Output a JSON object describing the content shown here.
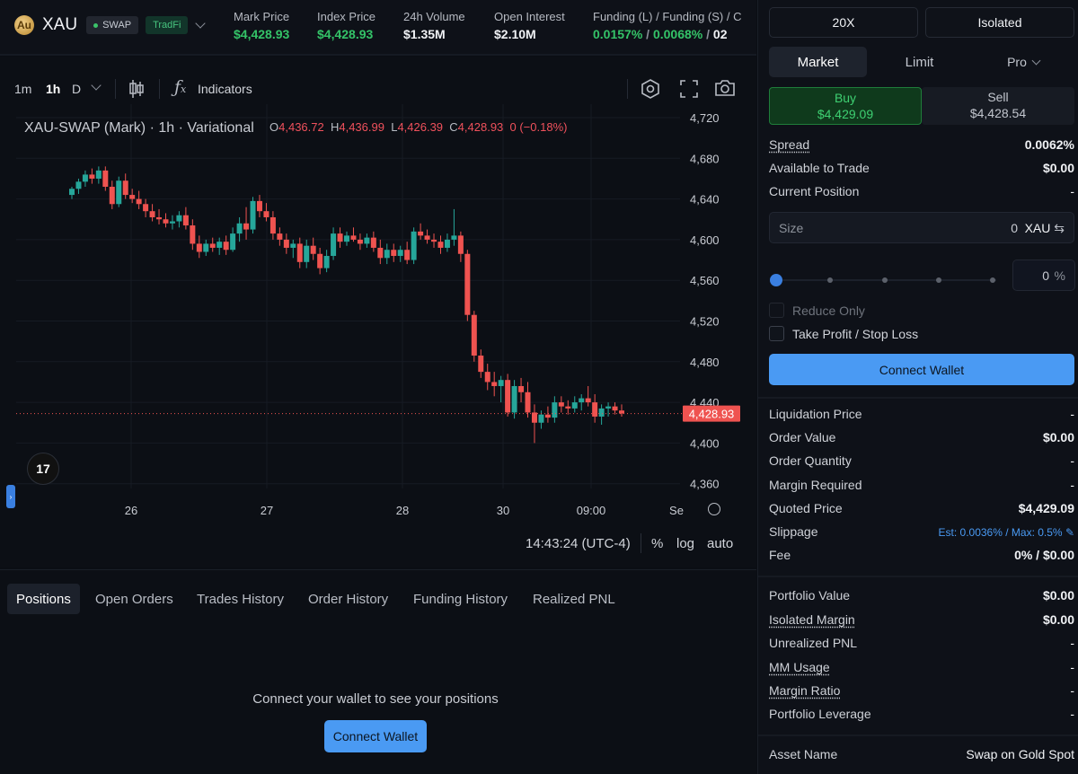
{
  "header": {
    "asset_symbol": "XAU",
    "badge_swap": "SWAP",
    "badge_tradfi": "TradFi",
    "stats": [
      {
        "label": "Mark Price",
        "value": "$4,428.93",
        "color": "#34c368"
      },
      {
        "label": "Index Price",
        "value": "$4,428.93",
        "color": "#34c368"
      },
      {
        "label": "24h Volume",
        "value": "$1.35M",
        "color": "#f0f2f5"
      },
      {
        "label": "Open Interest",
        "value": "$2.10M",
        "color": "#f0f2f5"
      }
    ],
    "funding": {
      "label": "Funding (L) / Funding (S) / C",
      "long": "0.0157%",
      "sep": "/",
      "short": "0.0068%",
      "sep2": "/",
      "extra": "02"
    }
  },
  "toolbar": {
    "timeframes": [
      "1m",
      "1h",
      "D"
    ],
    "active_timeframe": "1h",
    "indicators_label": "Indicators",
    "icons": [
      "candles-icon",
      "fx-icon",
      "settings-icon",
      "fullscreen-icon",
      "camera-icon"
    ]
  },
  "chart": {
    "title": "XAU-SWAP (Mark) · 1h · Variational",
    "ohlc": {
      "o_label": "O",
      "o": "4,436.72",
      "h_label": "H",
      "h": "4,436.99",
      "l_label": "L",
      "l": "4,426.39",
      "c_label": "C",
      "c": "4,428.93",
      "change": "0 (−0.18%)"
    },
    "last_price_label": "4,428.93",
    "time_readout": "14:43:24 (UTC-4)",
    "controls": {
      "percent": "%",
      "log": "log",
      "auto": "auto"
    },
    "x_label_extra": "Se"
  },
  "chart_data": {
    "type": "candlestick",
    "y_ticks": [
      4720,
      4680,
      4640,
      4600,
      4560,
      4520,
      4480,
      4440,
      4400,
      4360
    ],
    "y_tick_labels": [
      "4,720",
      "4,680",
      "4,640",
      "4,600",
      "4,560",
      "4,520",
      "4,480",
      "4,440",
      "4,400",
      "4,360"
    ],
    "x_tick_labels": [
      "26",
      "27",
      "28",
      "30",
      "09:00"
    ],
    "ylim": [
      4340,
      4740
    ],
    "last_price": 4428.93,
    "up_color": "#26a69a",
    "down_color": "#ef5350",
    "candles": [
      [
        4644,
        4652,
        4640,
        4650
      ],
      [
        4650,
        4660,
        4645,
        4657
      ],
      [
        4657,
        4668,
        4652,
        4664
      ],
      [
        4664,
        4670,
        4655,
        4660
      ],
      [
        4660,
        4672,
        4655,
        4668
      ],
      [
        4668,
        4672,
        4648,
        4652
      ],
      [
        4652,
        4658,
        4630,
        4635
      ],
      [
        4635,
        4662,
        4632,
        4658
      ],
      [
        4658,
        4665,
        4640,
        4644
      ],
      [
        4644,
        4650,
        4636,
        4640
      ],
      [
        4640,
        4648,
        4630,
        4635
      ],
      [
        4635,
        4640,
        4622,
        4628
      ],
      [
        4628,
        4635,
        4618,
        4622
      ],
      [
        4622,
        4630,
        4615,
        4620
      ],
      [
        4620,
        4626,
        4612,
        4616
      ],
      [
        4616,
        4624,
        4610,
        4618
      ],
      [
        4618,
        4628,
        4612,
        4624
      ],
      [
        4624,
        4632,
        4610,
        4614
      ],
      [
        4614,
        4620,
        4590,
        4596
      ],
      [
        4596,
        4604,
        4582,
        4588
      ],
      [
        4588,
        4600,
        4584,
        4596
      ],
      [
        4596,
        4602,
        4588,
        4592
      ],
      [
        4592,
        4602,
        4585,
        4598
      ],
      [
        4598,
        4604,
        4585,
        4590
      ],
      [
        4590,
        4612,
        4588,
        4606
      ],
      [
        4606,
        4622,
        4598,
        4616
      ],
      [
        4616,
        4632,
        4600,
        4610
      ],
      [
        4610,
        4642,
        4606,
        4638
      ],
      [
        4638,
        4644,
        4622,
        4628
      ],
      [
        4628,
        4636,
        4618,
        4622
      ],
      [
        4622,
        4628,
        4600,
        4606
      ],
      [
        4606,
        4612,
        4594,
        4600
      ],
      [
        4600,
        4606,
        4586,
        4592
      ],
      [
        4592,
        4600,
        4582,
        4596
      ],
      [
        4596,
        4602,
        4572,
        4578
      ],
      [
        4578,
        4600,
        4572,
        4594
      ],
      [
        4594,
        4602,
        4580,
        4586
      ],
      [
        4586,
        4592,
        4566,
        4572
      ],
      [
        4572,
        4590,
        4568,
        4584
      ],
      [
        4584,
        4612,
        4580,
        4606
      ],
      [
        4606,
        4612,
        4592,
        4598
      ],
      [
        4598,
        4608,
        4594,
        4604
      ],
      [
        4604,
        4612,
        4598,
        4600
      ],
      [
        4600,
        4606,
        4590,
        4596
      ],
      [
        4596,
        4606,
        4592,
        4602
      ],
      [
        4602,
        4608,
        4588,
        4592
      ],
      [
        4592,
        4600,
        4576,
        4582
      ],
      [
        4582,
        4596,
        4576,
        4590
      ],
      [
        4590,
        4596,
        4578,
        4584
      ],
      [
        4584,
        4594,
        4578,
        4590
      ],
      [
        4590,
        4598,
        4576,
        4580
      ],
      [
        4580,
        4612,
        4576,
        4608
      ],
      [
        4608,
        4616,
        4600,
        4604
      ],
      [
        4604,
        4610,
        4596,
        4600
      ],
      [
        4600,
        4606,
        4592,
        4598
      ],
      [
        4598,
        4604,
        4586,
        4592
      ],
      [
        4592,
        4606,
        4588,
        4600
      ],
      [
        4600,
        4630,
        4594,
        4604
      ],
      [
        4604,
        4608,
        4578,
        4586
      ],
      [
        4586,
        4590,
        4520,
        4526
      ],
      [
        4526,
        4530,
        4480,
        4486
      ],
      [
        4486,
        4492,
        4464,
        4470
      ],
      [
        4470,
        4478,
        4452,
        4460
      ],
      [
        4460,
        4470,
        4446,
        4456
      ],
      [
        4456,
        4466,
        4440,
        4462
      ],
      [
        4462,
        4468,
        4426,
        4430
      ],
      [
        4430,
        4462,
        4424,
        4456
      ],
      [
        4456,
        4464,
        4440,
        4450
      ],
      [
        4450,
        4460,
        4425,
        4430
      ],
      [
        4430,
        4438,
        4400,
        4420
      ],
      [
        4420,
        4432,
        4414,
        4428
      ],
      [
        4428,
        4436,
        4420,
        4425
      ],
      [
        4425,
        4446,
        4420,
        4440
      ],
      [
        4440,
        4446,
        4430,
        4436
      ],
      [
        4436,
        4442,
        4428,
        4434
      ],
      [
        4434,
        4446,
        4430,
        4440
      ],
      [
        4440,
        4448,
        4432,
        4444
      ],
      [
        4444,
        4456,
        4436,
        4440
      ],
      [
        4440,
        4448,
        4420,
        4426
      ],
      [
        4426,
        4438,
        4418,
        4434
      ],
      [
        4434,
        4440,
        4426,
        4436
      ],
      [
        4436,
        4440,
        4428,
        4432
      ],
      [
        4432,
        4438,
        4426,
        4429
      ]
    ]
  },
  "tabs": {
    "items": [
      "Positions",
      "Open Orders",
      "Trades History",
      "Order History",
      "Funding History",
      "Realized PNL"
    ],
    "active": "Positions",
    "empty_message": "Connect your wallet to see your positions",
    "connect_label": "Connect Wallet"
  },
  "panel": {
    "leverage": "20X",
    "margin_mode": "Isolated",
    "order_types": [
      "Market",
      "Limit",
      "Pro"
    ],
    "active_order_type": "Market",
    "buy_label": "Buy",
    "buy_price": "$4,429.09",
    "sell_label": "Sell",
    "sell_price": "$4,428.54",
    "info_rows": [
      {
        "label": "Spread",
        "value": "0.0062%"
      },
      {
        "label": "Available to Trade",
        "value": "$0.00"
      },
      {
        "label": "Current Position",
        "value": "-"
      }
    ],
    "size": {
      "placeholder": "Size",
      "value": "0",
      "unit": "XAU"
    },
    "slider_percent": "0",
    "percent_sign": "%",
    "reduce_only": "Reduce Only",
    "tp_sl": "Take Profit / Stop Loss",
    "connect_label": "Connect Wallet",
    "order_rows": [
      {
        "label": "Liquidation Price",
        "value": "-"
      },
      {
        "label": "Order Value",
        "value": "$0.00"
      },
      {
        "label": "Order Quantity",
        "value": "-"
      },
      {
        "label": "Margin Required",
        "value": "-"
      },
      {
        "label": "Quoted Price",
        "value": "$4,429.09"
      },
      {
        "label": "Slippage",
        "value": "Est: 0.0036% / Max: 0.5%"
      },
      {
        "label": "Fee",
        "value": "0% / $0.00"
      }
    ],
    "portfolio_rows": [
      {
        "label": "Portfolio Value",
        "value": "$0.00"
      },
      {
        "label": "Isolated Margin",
        "value": "$0.00"
      },
      {
        "label": "Unrealized PNL",
        "value": "-"
      },
      {
        "label": "MM Usage",
        "value": "-"
      },
      {
        "label": "Margin Ratio",
        "value": "-"
      },
      {
        "label": "Portfolio Leverage",
        "value": "-"
      }
    ],
    "asset_row": {
      "label": "Asset Name",
      "value": "Swap on Gold Spot"
    }
  }
}
